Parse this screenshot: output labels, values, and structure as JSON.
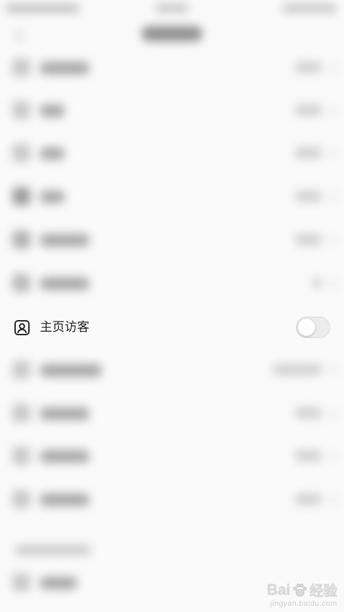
{
  "visitor_setting": {
    "label": "主页访客",
    "toggle_on": false
  },
  "watermark": {
    "brand": "Bai",
    "brand_suffix": "经验",
    "url": "jingyan.baidu.com"
  },
  "colors": {
    "background": "#fafafa",
    "text": "#222222",
    "toggle_off_track": "#ececec"
  },
  "icons": {
    "visitor": "person-card-icon",
    "back": "back-arrow-icon",
    "watermark_logo": "paw-icon"
  }
}
